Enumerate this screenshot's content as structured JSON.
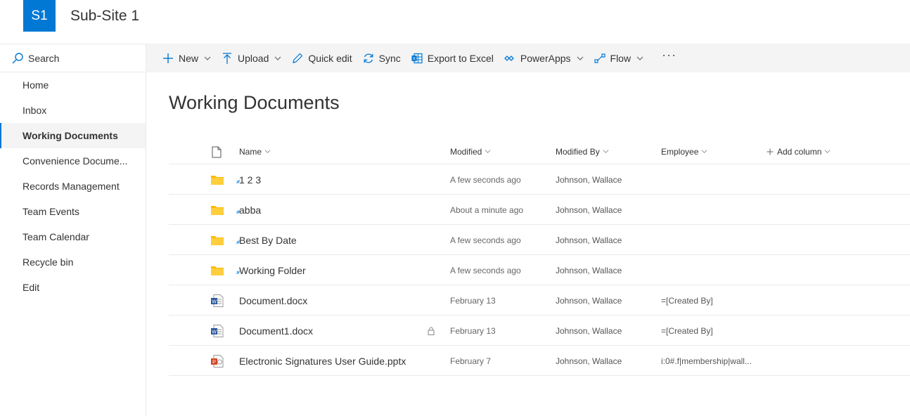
{
  "header": {
    "logo_text": "S1",
    "site_title": "Sub-Site 1",
    "accent": "#0078d4"
  },
  "sidebar": {
    "search_label": "Search",
    "items": [
      {
        "label": "Home",
        "active": false
      },
      {
        "label": "Inbox",
        "active": false
      },
      {
        "label": "Working Documents",
        "active": true
      },
      {
        "label": "Convenience Docume...",
        "active": false
      },
      {
        "label": "Records Management",
        "active": false
      },
      {
        "label": "Team Events",
        "active": false
      },
      {
        "label": "Team Calendar",
        "active": false
      },
      {
        "label": "Recycle bin",
        "active": false
      },
      {
        "label": "Edit",
        "active": false
      }
    ]
  },
  "commandbar": {
    "new": "New",
    "upload": "Upload",
    "quick_edit": "Quick edit",
    "sync": "Sync",
    "export": "Export to Excel",
    "powerapps": "PowerApps",
    "flow": "Flow",
    "more": "···"
  },
  "main": {
    "title": "Working Documents",
    "columns": {
      "name": "Name",
      "modified": "Modified",
      "modified_by": "Modified By",
      "employee": "Employee",
      "add_column": "Add column"
    },
    "rows": [
      {
        "type": "folder",
        "name": "1 2 3",
        "modified": "A few seconds ago",
        "modified_by": "Johnson, Wallace",
        "employee": "",
        "new": true
      },
      {
        "type": "folder",
        "name": "abba",
        "modified": "About a minute ago",
        "modified_by": "Johnson, Wallace",
        "employee": "",
        "new": true
      },
      {
        "type": "folder",
        "name": "Best By Date",
        "modified": "A few seconds ago",
        "modified_by": "Johnson, Wallace",
        "employee": "",
        "new": true
      },
      {
        "type": "folder",
        "name": "Working Folder",
        "modified": "A few seconds ago",
        "modified_by": "Johnson, Wallace",
        "employee": "",
        "new": true
      },
      {
        "type": "word",
        "name": "Document.docx",
        "modified": "February 13",
        "modified_by": "Johnson, Wallace",
        "employee": "=[Created By]",
        "new": false
      },
      {
        "type": "word",
        "name": "Document1.docx",
        "modified": "February 13",
        "modified_by": "Johnson, Wallace",
        "employee": "=[Created By]",
        "new": false,
        "locked": true
      },
      {
        "type": "powerpoint",
        "name": "Electronic Signatures User Guide.pptx",
        "modified": "February 7",
        "modified_by": "Johnson, Wallace",
        "employee": "i:0#.f|membership|wall...",
        "new": false
      }
    ]
  }
}
